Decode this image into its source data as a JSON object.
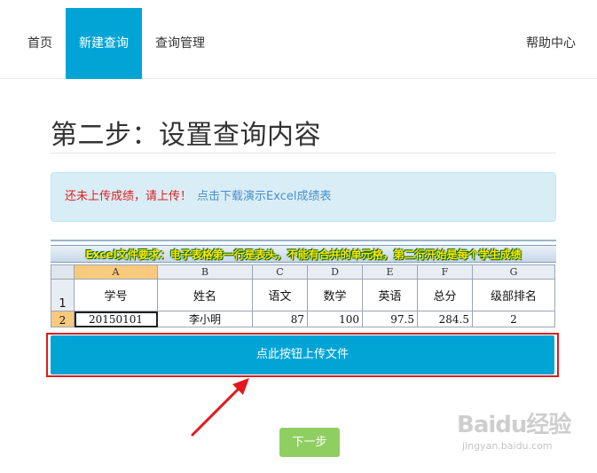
{
  "nav": {
    "home": "首页",
    "new_query": "新建查询",
    "manage": "查询管理",
    "help": "帮助中心"
  },
  "page": {
    "title": "第二步：设置查询内容"
  },
  "alert": {
    "warning": "还未上传成绩，请上传！",
    "link": "点击下载演示Excel成绩表"
  },
  "sample_sheet": {
    "banner": "Excel文件要求：电子表格第一行是表头，不能有合并的单元格，第二行开始是每个学生成绩",
    "columns": [
      "A",
      "B",
      "C",
      "D",
      "E",
      "F",
      "G"
    ],
    "rows": [
      {
        "num": "1",
        "cells": [
          "学号",
          "姓名",
          "语文",
          "数学",
          "英语",
          "总分",
          "级部排名"
        ]
      },
      {
        "num": "2",
        "cells": [
          "20150101",
          "李小明",
          "87",
          "100",
          "97.5",
          "284.5",
          "2"
        ]
      }
    ]
  },
  "buttons": {
    "upload": "点此按钮上传文件",
    "next": "下一步"
  },
  "watermark": {
    "main": "Baidu经验",
    "sub": "jingyan.baidu.com"
  },
  "colors": {
    "accent": "#00a5d6",
    "highlight_border": "#e2191b",
    "next_button": "#8fcf61",
    "alert_bg": "#d9edf7"
  }
}
